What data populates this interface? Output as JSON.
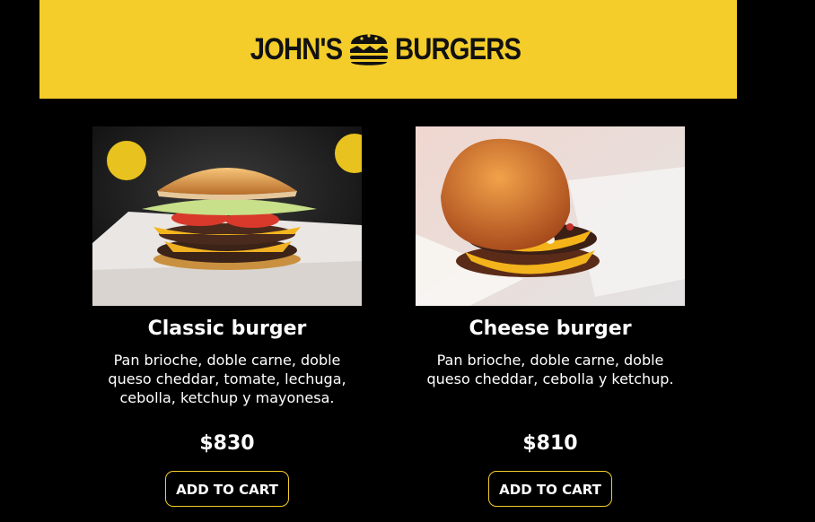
{
  "brand": {
    "name_left": "JOHN'S",
    "name_right": "BURGERS",
    "header_color": "#f4cd2a"
  },
  "products": [
    {
      "title": "Classic burger",
      "description": "Pan brioche, doble carne, doble queso cheddar, tomate, lechuga, cebolla, ketchup y mayonesa.",
      "price": "$830",
      "button": "ADD TO CART",
      "image": "classic-burger-photo"
    },
    {
      "title": "Cheese burger",
      "description": "Pan brioche, doble carne, doble queso cheddar, cebolla y ketchup.",
      "price": "$810",
      "button": "ADD TO CART",
      "image": "cheese-burger-photo"
    }
  ]
}
